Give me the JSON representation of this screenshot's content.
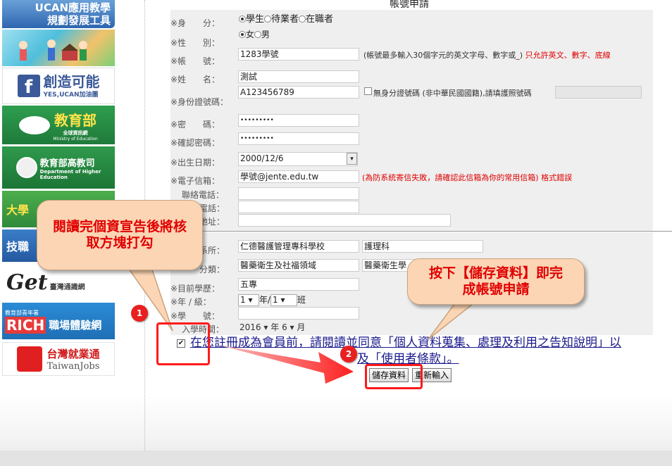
{
  "form": {
    "title": "帳號申請",
    "identity": {
      "label": "※身　　分：",
      "options": [
        "學生",
        "待業者",
        "在職者"
      ],
      "selected": "學生"
    },
    "gender": {
      "label": "※性　　別：",
      "options": [
        "女",
        "男"
      ],
      "selected": "女"
    },
    "account": {
      "label": "※帳　　號：",
      "value": "1283學號",
      "note": "(帳號最多輸入30個字元的英文字母、數字或_)",
      "note_red": "只允許英文、數字、底線"
    },
    "name": {
      "label": "※姓　　名：",
      "value": "測試"
    },
    "id_number": {
      "label": "※身份證號碼：",
      "value": "A123456789",
      "checkbox_label": "無身分證號碼 (非中華民國國籍),請填護照號碼",
      "passport_value": ""
    },
    "password": {
      "label": "※密　　碼：",
      "value": "•••••••••"
    },
    "confirm_password": {
      "label": "※確認密碼：",
      "value": "•••••••••"
    },
    "birthday": {
      "label": "※出生日期：",
      "value": "2000/12/6"
    },
    "email": {
      "label": "※電子信箱：",
      "value": "學號@jente.edu.tw",
      "note_red": "(為防系統寄信失敗，請確認此信箱為你的常用信箱) 格式錯誤"
    },
    "phone": {
      "label": "聯絡電話：",
      "value": ""
    },
    "mobile": {
      "label": "電話：",
      "value": ""
    },
    "address": {
      "label": "地址：",
      "value": ""
    },
    "school_dept": {
      "label": "系所：",
      "school": "仁德醫護管理專科學校",
      "dept": "護理科"
    },
    "category": {
      "label": "分類：",
      "field": "醫藥衛生及社福領域",
      "sub": "醫藥衛生學"
    },
    "education": {
      "label": "※目前學歷：",
      "value": "五專"
    },
    "grade": {
      "label": "※年 / 級：",
      "year": "1",
      "year_unit": "年/",
      "class": "1",
      "class_unit": "班"
    },
    "student_id": {
      "label": "※學　　號：",
      "value": ""
    },
    "enroll": {
      "label": "入學時間：",
      "year": "2016",
      "year_unit": "年",
      "month": "6",
      "month_unit": "月"
    },
    "consent_checked": true,
    "consent_text_1": "在您註冊成為會員前，請閱讀並同意「個人資料蒐集、處理及利用之告知說明」以",
    "consent_text_2": "及「使用者條款」。",
    "save_label": "儲存資料",
    "reset_label": "重新輸入"
  },
  "sidebar": {
    "ucan_line1": "UCAN應用教學",
    "ucan_line2": "規劃發展工具",
    "fb_main": "創造可能",
    "fb_sub": "YES,UCAN加油團",
    "moe_name": "教育部",
    "moe_sub": "全球資訊網",
    "moe_en": "Ministry of Education",
    "he_name": "教育部高教司",
    "he_en1": "Department of Higher",
    "he_en2": "Education",
    "uni_tile": "大學",
    "job_tile": "技職",
    "get_brand": "Get",
    "get_name": "臺灣通識網",
    "rich_top": "教育部青年署",
    "rich_brand": "RICH",
    "rich_name": "職場體驗網",
    "tj_name": "台灣就業通",
    "tj_en": "TaiwanJobs"
  },
  "callouts": {
    "left": "閱讀完個資宣告後將核取方塊打勾",
    "right": "按下【儲存資料】即完成帳號申請",
    "badge_1": "1",
    "badge_2": "2"
  },
  "colors": {
    "callout_bg": "#fcd5b5",
    "callout_text": "#e00000",
    "highlight": "#ff1a1a",
    "link": "#1a1a8c"
  }
}
